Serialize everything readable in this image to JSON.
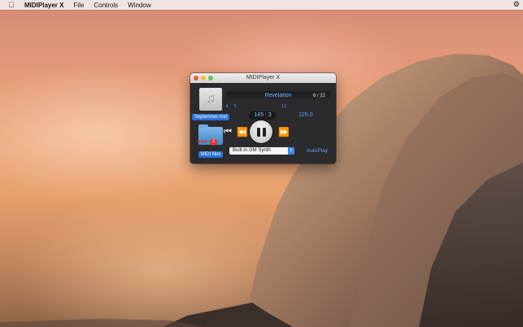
{
  "menubar": {
    "apple_icon": "apple-icon",
    "app_name": "MIDIPlayer X",
    "menus": [
      "File",
      "Controls",
      "Window"
    ]
  },
  "window": {
    "title": "MIDIPlayer X",
    "song_title": "Revelation",
    "song_count": "6 / 22",
    "ruler_numbers": [
      "4",
      "5",
      "",
      "",
      "",
      "",
      "",
      "10",
      "",
      "",
      "",
      "",
      ""
    ],
    "filename": "September.mid",
    "position": "145 : 3",
    "tempo": "125.0",
    "folder_label": "MIDI files",
    "folder_badge": "2",
    "synth_selected": "Built-in GM Synth",
    "autoplay_label": "AutoPlay",
    "colors": {
      "accent": "#2a72d6",
      "text_accent": "#5aa6ff"
    }
  }
}
